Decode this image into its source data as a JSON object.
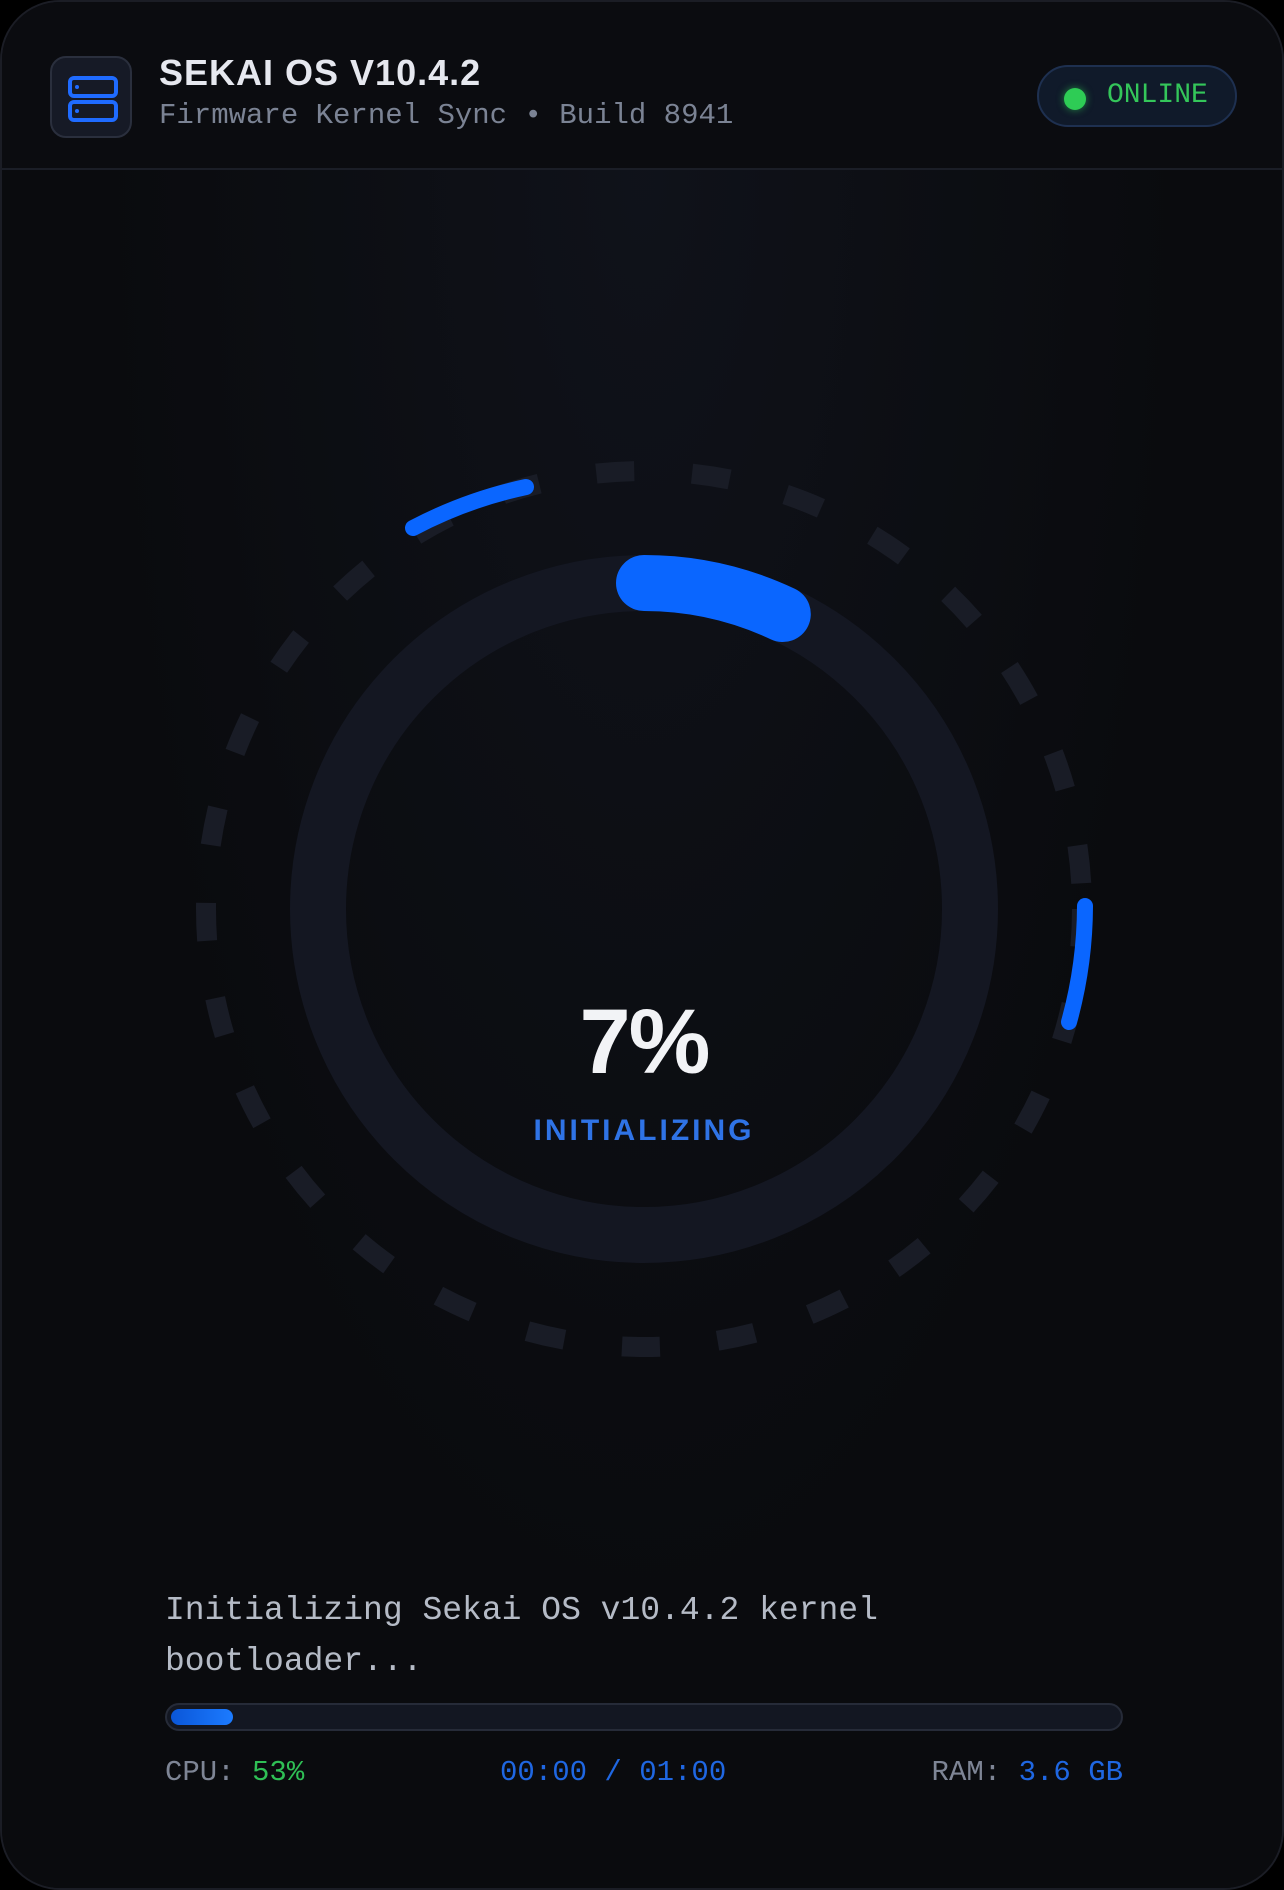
{
  "header": {
    "title": "SEKAI OS V10.4.2",
    "subtitle": "Firmware Kernel Sync • Build 8941",
    "icon": "server-icon",
    "status": {
      "label": "ONLINE",
      "color": "#2ecc55"
    }
  },
  "loader": {
    "progress_percent": 7,
    "percent_label": "7%",
    "phase_label": "INITIALIZING",
    "accent_color": "#0a66ff"
  },
  "log": {
    "message": "Initializing Sekai OS v10.4.2 kernel bootloader..."
  },
  "stats": {
    "cpu_label": "CPU:",
    "cpu_value": "53%",
    "time": "00:00 / 01:00",
    "ram_label": "RAM:",
    "ram_value": "3.6 GB"
  }
}
